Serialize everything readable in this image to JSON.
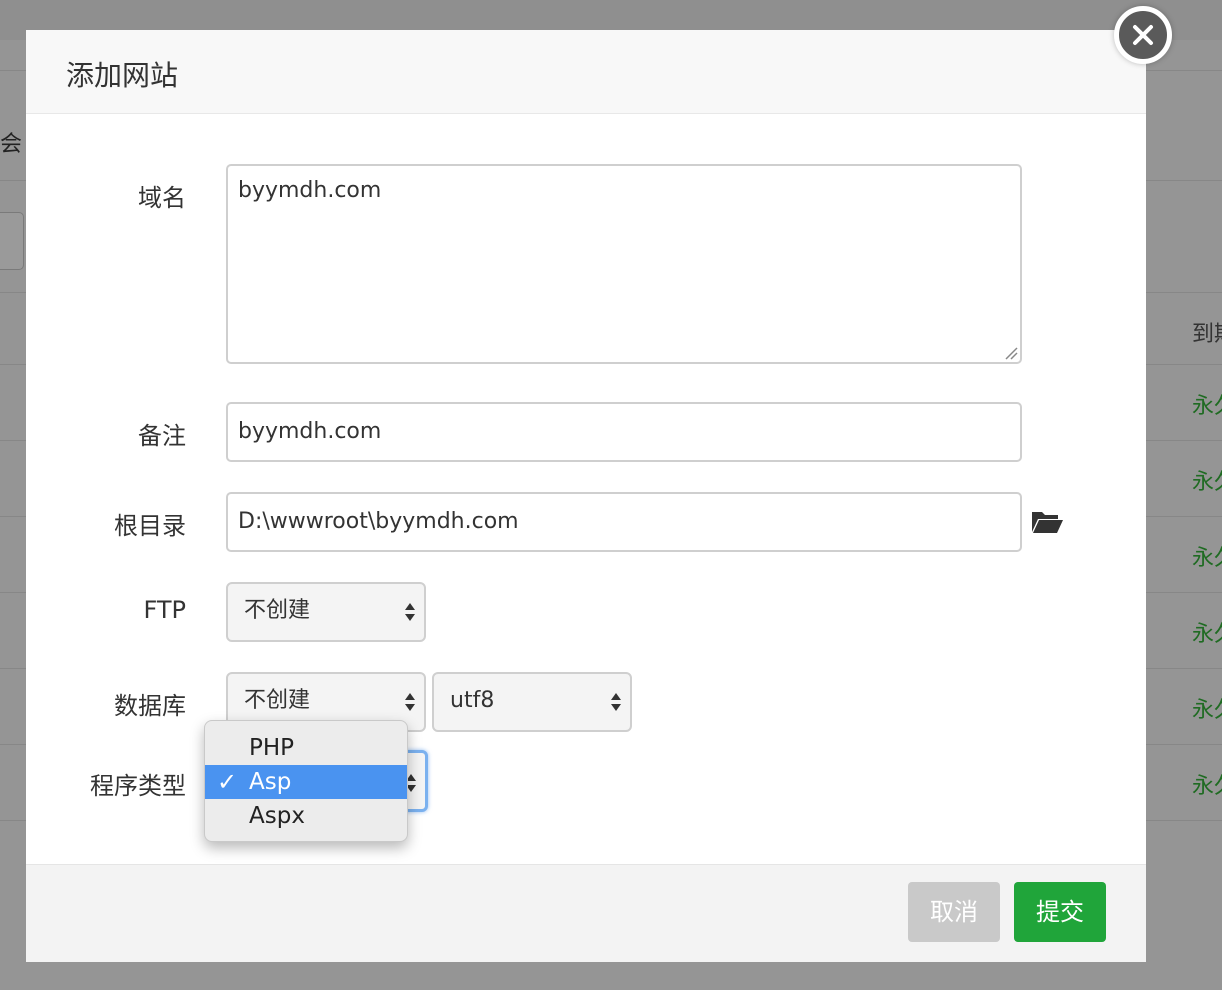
{
  "modal": {
    "title": "添加网站",
    "close_icon": "close-icon"
  },
  "form": {
    "domain": {
      "label": "域名",
      "value": "byymdh.com"
    },
    "remark": {
      "label": "备注",
      "value": "byymdh.com"
    },
    "root": {
      "label": "根目录",
      "value": "D:\\wwwroot\\byymdh.com",
      "icon": "folder-open-icon"
    },
    "ftp": {
      "label": "FTP",
      "selected": "不创建"
    },
    "database": {
      "label": "数据库",
      "selected": "不创建",
      "charset": "utf8"
    },
    "program_type": {
      "label": "程序类型",
      "options": [
        "PHP",
        "Asp",
        "Aspx"
      ],
      "selected": "Asp"
    }
  },
  "footer": {
    "cancel_label": "取消",
    "submit_label": "提交"
  },
  "background": {
    "left_text": "会",
    "right_header": "到期",
    "right_cells": [
      "永久",
      "永久",
      "永久",
      "永久",
      "永久",
      "永久"
    ]
  },
  "colors": {
    "submit": "#20a53a",
    "cancel": "#c9c9c9",
    "dropdown_selected": "#4a93f0",
    "expiry_text": "#1f6b22"
  }
}
